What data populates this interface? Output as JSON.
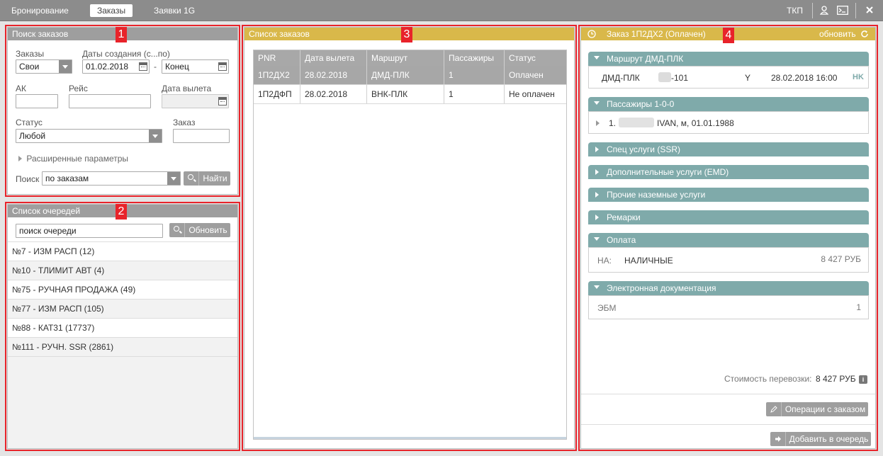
{
  "topbar": {
    "tabs": [
      "Бронирование",
      "Заказы",
      "Заявки 1G"
    ],
    "active_tab": "Заказы",
    "user": "ТКП"
  },
  "search_panel": {
    "title": "Поиск заказов",
    "marker": "1",
    "orders_label": "Заказы",
    "orders_value": "Свои",
    "dates_label": "Даты создания (с...по)",
    "date_from": "01.02.2018",
    "date_dash": "-",
    "date_to": "Конец",
    "ak_label": "АК",
    "flight_label": "Рейс",
    "depdate_label": "Дата вылета",
    "status_label": "Статус",
    "status_value": "Любой",
    "order_label": "Заказ",
    "advanced": "Расширенные параметры",
    "search_label": "Поиск",
    "search_value": "по заказам",
    "find_btn": "Найти"
  },
  "queue_panel": {
    "title": "Список очередей",
    "marker": "2",
    "search_value": "поиск очереди",
    "refresh_btn": "Обновить",
    "items": [
      "№7 - ИЗМ РАСП (12)",
      "№10 - ТЛИМИТ АВТ (4)",
      "№75 - РУЧНАЯ ПРОДАЖА (49)",
      "№77 - ИЗМ РАСП (105)",
      "№88 - КАТ31 (17737)",
      "№111 - РУЧН. SSR (2861)"
    ]
  },
  "orders_panel": {
    "title": "Список заказов",
    "marker": "3",
    "columns": [
      "PNR",
      "Дата вылета",
      "Маршрут",
      "Пассажиры",
      "Статус"
    ],
    "rows": [
      [
        "1П2ДХ2",
        "28.02.2018",
        "ДМД-ПЛК",
        "1",
        "Оплачен"
      ],
      [
        "1П2ДФП",
        "28.02.2018",
        "ВНК-ПЛК",
        "1",
        "Не оплачен"
      ]
    ]
  },
  "detail_panel": {
    "title": "Заказ 1П2ДХ2 (Оплачен)",
    "marker": "4",
    "refresh": "обновить",
    "route_section": "Маршрут ДМД-ПЛК",
    "route": {
      "route": "ДМД-ПЛК",
      "flight": "-101",
      "class": "Y",
      "datetime": "28.02.2018 16:00",
      "status": "HK"
    },
    "pax_section": "Пассажиры 1-0-0",
    "pax": {
      "index": "1.",
      "info": "IVAN, м, 01.01.1988"
    },
    "ssr_section": "Спец услуги (SSR)",
    "emd_section": "Дополнительные услуги (EMD)",
    "ground_section": "Прочие наземные услуги",
    "remarks_section": "Ремарки",
    "payment_section": "Оплата",
    "payment": {
      "code": "НА:",
      "type": "НАЛИЧНЫЕ",
      "amount": "8 427 РУБ"
    },
    "edoc_section": "Электронная документация",
    "edoc": {
      "label": "ЭБМ",
      "count": "1"
    },
    "cost_label": "Стоимость перевозки:",
    "cost_value": "8 427 РУБ",
    "ops_btn": "Операции с заказом",
    "queue_btn": "Добавить в очередь"
  }
}
